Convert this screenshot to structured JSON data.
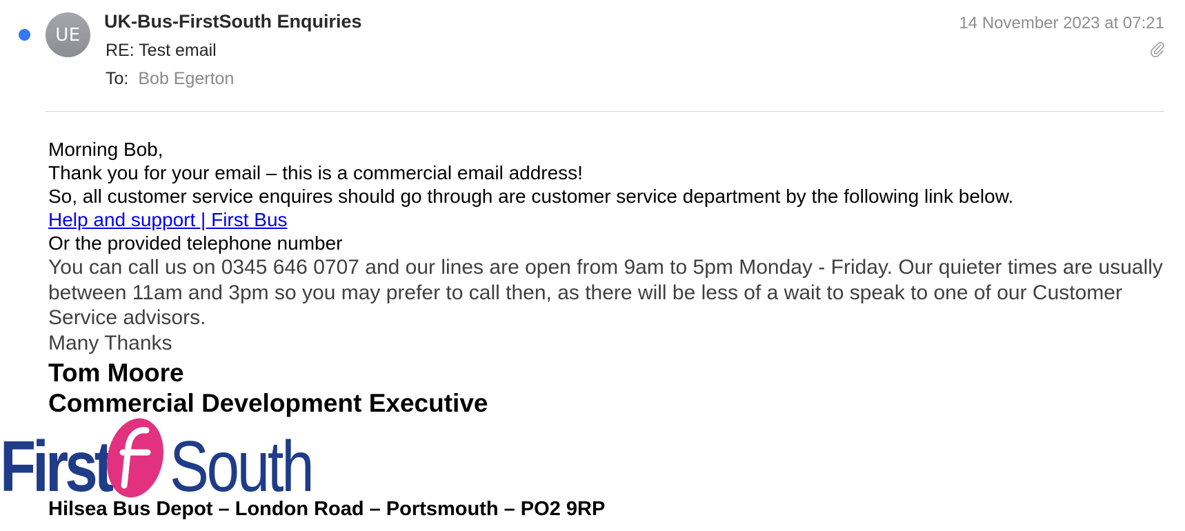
{
  "header": {
    "avatar_initials": "UE",
    "sender": "UK-Bus-FirstSouth Enquiries",
    "subject": "RE: Test email",
    "to_label": "To:",
    "to_name": "Bob Egerton",
    "date": "14 November 2023 at 07:21",
    "unread_color": "#3478f6",
    "attachment_icon": "paperclip-icon"
  },
  "body": {
    "greeting": "Morning Bob,",
    "line1": "Thank you for your email – this is a commercial email address!",
    "line2": "So, all customer service enquires should go through are customer service department by the following link below.",
    "link_text": "Help and support | First Bus",
    "line3": "Or the provided telephone number",
    "phone_paragraph": "You can call us on 0345 646 0707 and our lines are open from 9am to 5pm Monday - Friday. Our quieter times are usually between 11am and 3pm so you may prefer to call then, as there will be less of a wait to speak to one of our Customer Service advisors.",
    "signoff": "Many Thanks"
  },
  "signature": {
    "name": "Tom Moore",
    "title": "Commercial Development Executive",
    "logo": {
      "word1": "First",
      "word2": "South",
      "brand_navy": "#1f3c88",
      "brand_pink": "#e2317e"
    },
    "address": "Hilsea Bus Depot – London Road – Portsmouth – PO2 9RP"
  },
  "colors": {
    "link": "#0000ee",
    "date_grey": "#8e8e8e",
    "body_grey": "#404040"
  }
}
